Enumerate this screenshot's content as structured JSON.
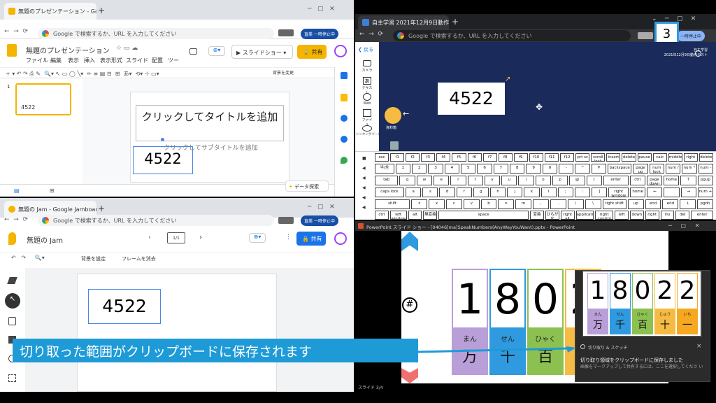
{
  "slides_window": {
    "tab_title": "無題のプレゼンテーション - Google ス",
    "new_tab": "+",
    "omnibox_placeholder": "Google で検索するか、URL を入力してください",
    "pause_badge": "一時停止中",
    "profile_label": "直美",
    "doc_title": "無題のプレゼンテーション",
    "menus": [
      "ファイル",
      "編集",
      "表示",
      "挿入",
      "表示形式",
      "スライド",
      "配置",
      "ツー"
    ],
    "slideshow_button": "スライドショー",
    "share_button": "共有",
    "bg_button": "背景を変更",
    "slide_number": "1",
    "thumb_text": "4522",
    "title_placeholder": "クリックしてタイトルを追加",
    "subtitle_placeholder": "クリックしてサブタイトルを追加",
    "textbox_value": "4522",
    "explore_button": "データ探索"
  },
  "jam_window": {
    "tab_title": "無題の Jam - Google Jamboard",
    "new_tab": "+",
    "omnibox_placeholder": "Google で検索するか、URL を入力してください",
    "pause_badge": "一時停止中",
    "profile_label": "直美",
    "doc_title": "無題の Jam",
    "frame_counter": "1/1",
    "share_button": "共有",
    "set_bg_button": "背景を設定",
    "clear_frame_button": "フレームを消去",
    "frame_text": "4522"
  },
  "study_window": {
    "tab_title": "自主学習 2021年12月9日動作テ",
    "new_tab": "+",
    "omnibox_placeholder": "Google で検索するか、URL を入力してください",
    "pause_badge": "一時停止中",
    "profile_label": "直美",
    "step_badge": "3",
    "back_label": "戻る",
    "app_header_line1": "自主学習",
    "app_header_line2": "2021年12月9日動作テスト",
    "tools": [
      "カメラ",
      "テキスト",
      "Web",
      "ファイル",
      "シンキングツール"
    ],
    "material_label": "資料箱",
    "card_value": "4522",
    "keyboard_rows": [
      [
        "esc",
        "f1",
        "f2",
        "f3",
        "f4",
        "f5",
        "f6",
        "f7",
        "f8",
        "f9",
        "f10",
        "f11",
        "f12",
        "prt sc",
        "scroll lock",
        "insert",
        "delete",
        "pause",
        "calc",
        "middle",
        "right",
        "delete"
      ],
      [
        "半/全",
        "1",
        "2",
        "3",
        "4",
        "5",
        "6",
        "7",
        "8",
        "9",
        "0",
        "-",
        "^",
        "¥",
        "backspace",
        "page up",
        "num lock",
        "num /",
        "num *",
        "num -"
      ],
      [
        "tab",
        "q",
        "w",
        "e",
        "r",
        "t",
        "y",
        "u",
        "i",
        "o",
        "p",
        "@",
        "[",
        "enter",
        "ctrl",
        "page down",
        "home",
        "↑",
        "pgup"
      ],
      [
        "caps lock",
        "a",
        "s",
        "d",
        "f",
        "g",
        "h",
        "j",
        "k",
        "l",
        ";",
        ":",
        "]",
        "right window",
        "home",
        "←",
        "",
        "→",
        "num +"
      ],
      [
        "shift",
        "z",
        "x",
        "c",
        "v",
        "b",
        "n",
        "m",
        ",",
        ".",
        "/",
        "\\",
        "right shift",
        "up",
        "end",
        "end",
        "↓",
        "pgdn"
      ],
      [
        "ctrl",
        "left window",
        "alt",
        "無変換",
        "space",
        "変換",
        "ひらがな",
        "right alt",
        "application",
        "right control",
        "left",
        "down",
        "right",
        "ins",
        "del",
        "enter"
      ]
    ]
  },
  "ppt_window": {
    "title": "PowerPoint スライド ショー - [04046[ma]SpeakNumbers(AnyWayYouWant).pptx - PowerPoint",
    "hash_symbol": "#",
    "digits": [
      "1",
      "8",
      "0",
      "2"
    ],
    "place_kana": [
      "まん",
      "せん",
      "ひゃく",
      ""
    ],
    "place_kanji": [
      "万",
      "千",
      "百",
      ""
    ],
    "status": "スライド 3/4",
    "digit_colors": [
      "#b89fd8",
      "#2f9ae0",
      "#8cc152",
      "#f6bb42"
    ]
  },
  "snip": {
    "digits": [
      "1",
      "8",
      "0",
      "2",
      "2"
    ],
    "kana": [
      "まん",
      "せん",
      "ひゃく",
      "じゅう",
      "いち"
    ],
    "kanji": [
      "万",
      "千",
      "百",
      "十",
      "一"
    ],
    "colors": [
      "#b89fd8",
      "#2f9ae0",
      "#8cc152",
      "#f6bb42",
      "#f6a821"
    ],
    "app_name": "切り取り & スケッチ",
    "close": "×",
    "line1": "切り取り領域をクリップボードに保存しました",
    "line2": "画像をマークアップして共有するには、ここを選択してくださ い"
  },
  "caption": "切り取った範囲がクリップボードに保存されます"
}
